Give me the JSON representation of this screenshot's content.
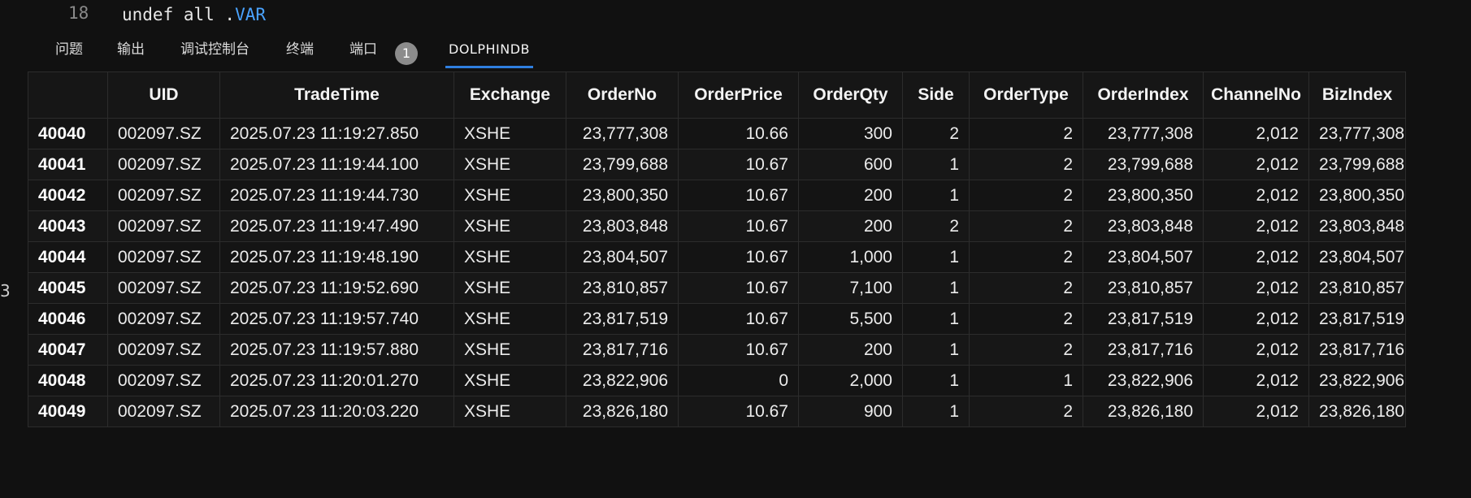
{
  "editor": {
    "line_number": "18",
    "code_prefix": "undef all .",
    "code_var": "VAR"
  },
  "panel_tabs": [
    {
      "label": "问题"
    },
    {
      "label": "输出"
    },
    {
      "label": "调试控制台"
    },
    {
      "label": "终端"
    },
    {
      "label": "端口"
    },
    {
      "label": "DOLPHINDB"
    }
  ],
  "ports_badge": "1",
  "gutter_mark": "3",
  "table": {
    "columns": [
      "UID",
      "TradeTime",
      "Exchange",
      "OrderNo",
      "OrderPrice",
      "OrderQty",
      "Side",
      "OrderType",
      "OrderIndex",
      "ChannelNo",
      "BizIndex"
    ],
    "rows": [
      {
        "idx": "40040",
        "cells": [
          "002097.SZ",
          "2025.07.23 11:19:27.850",
          "XSHE",
          "23,777,308",
          "10.66",
          "300",
          "2",
          "2",
          "23,777,308",
          "2,012",
          "23,777,308"
        ]
      },
      {
        "idx": "40041",
        "cells": [
          "002097.SZ",
          "2025.07.23 11:19:44.100",
          "XSHE",
          "23,799,688",
          "10.67",
          "600",
          "1",
          "2",
          "23,799,688",
          "2,012",
          "23,799,688"
        ]
      },
      {
        "idx": "40042",
        "cells": [
          "002097.SZ",
          "2025.07.23 11:19:44.730",
          "XSHE",
          "23,800,350",
          "10.67",
          "200",
          "1",
          "2",
          "23,800,350",
          "2,012",
          "23,800,350"
        ]
      },
      {
        "idx": "40043",
        "cells": [
          "002097.SZ",
          "2025.07.23 11:19:47.490",
          "XSHE",
          "23,803,848",
          "10.67",
          "200",
          "2",
          "2",
          "23,803,848",
          "2,012",
          "23,803,848"
        ]
      },
      {
        "idx": "40044",
        "cells": [
          "002097.SZ",
          "2025.07.23 11:19:48.190",
          "XSHE",
          "23,804,507",
          "10.67",
          "1,000",
          "1",
          "2",
          "23,804,507",
          "2,012",
          "23,804,507"
        ]
      },
      {
        "idx": "40045",
        "cells": [
          "002097.SZ",
          "2025.07.23 11:19:52.690",
          "XSHE",
          "23,810,857",
          "10.67",
          "7,100",
          "1",
          "2",
          "23,810,857",
          "2,012",
          "23,810,857"
        ]
      },
      {
        "idx": "40046",
        "cells": [
          "002097.SZ",
          "2025.07.23 11:19:57.740",
          "XSHE",
          "23,817,519",
          "10.67",
          "5,500",
          "1",
          "2",
          "23,817,519",
          "2,012",
          "23,817,519"
        ]
      },
      {
        "idx": "40047",
        "cells": [
          "002097.SZ",
          "2025.07.23 11:19:57.880",
          "XSHE",
          "23,817,716",
          "10.67",
          "200",
          "1",
          "2",
          "23,817,716",
          "2,012",
          "23,817,716"
        ]
      },
      {
        "idx": "40048",
        "cells": [
          "002097.SZ",
          "2025.07.23 11:20:01.270",
          "XSHE",
          "23,822,906",
          "0",
          "2,000",
          "1",
          "1",
          "23,822,906",
          "2,012",
          "23,822,906"
        ]
      },
      {
        "idx": "40049",
        "cells": [
          "002097.SZ",
          "2025.07.23 11:20:03.220",
          "XSHE",
          "23,826,180",
          "10.67",
          "900",
          "1",
          "2",
          "23,826,180",
          "2,012",
          "23,826,180"
        ]
      }
    ]
  }
}
